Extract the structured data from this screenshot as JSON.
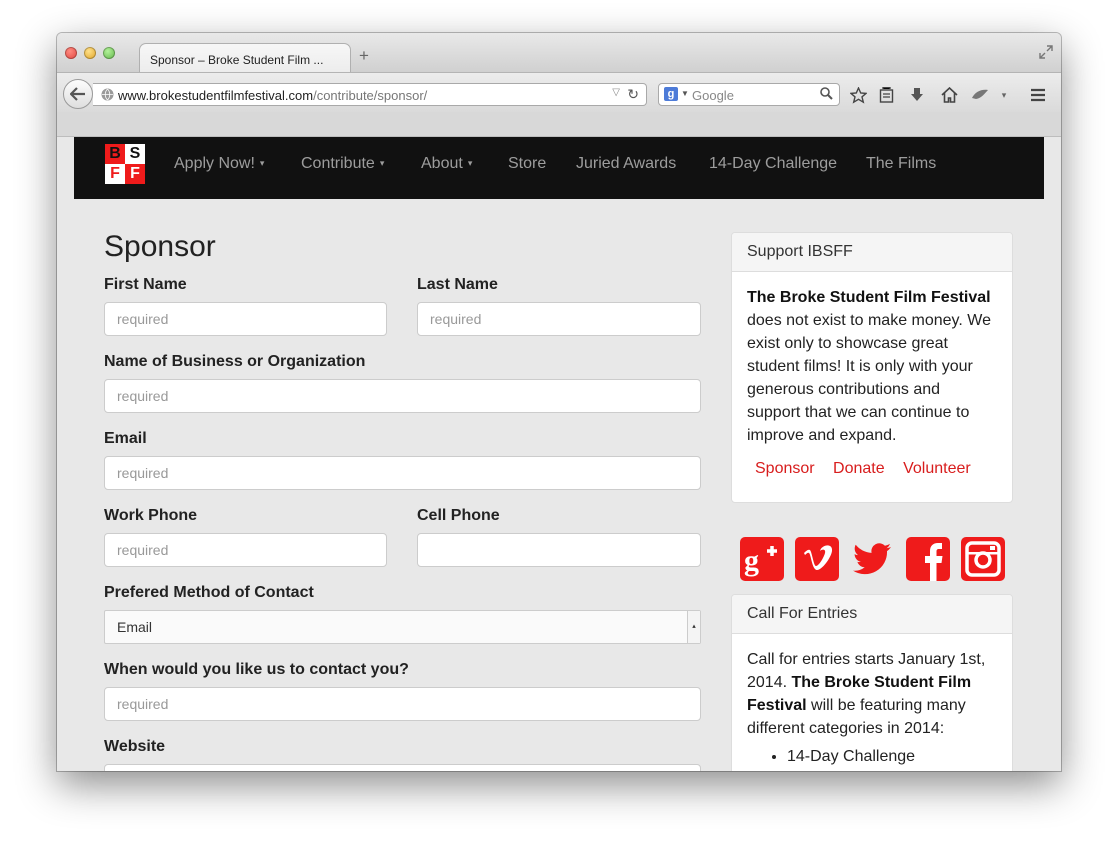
{
  "browser": {
    "tab_title": "Sponsor – Broke Student Film ...",
    "new_tab_symbol": "+",
    "url_host": "www.brokestudentfilmfestival.com",
    "url_path": "/contribute/sponsor/",
    "search_placeholder": "Google"
  },
  "site": {
    "logo_letters": [
      "B",
      "S",
      "F",
      "F"
    ],
    "nav": [
      {
        "label": "Apply Now!",
        "dropdown": true
      },
      {
        "label": "Contribute",
        "dropdown": true
      },
      {
        "label": "About",
        "dropdown": true
      },
      {
        "label": "Store",
        "dropdown": false
      },
      {
        "label": "Juried Awards",
        "dropdown": false
      },
      {
        "label": "14-Day Challenge",
        "dropdown": false
      },
      {
        "label": "The Films",
        "dropdown": false
      }
    ],
    "caret_symbol": "▾"
  },
  "form": {
    "title": "Sponsor",
    "first_name": {
      "label": "First Name",
      "placeholder": "required"
    },
    "last_name": {
      "label": "Last Name",
      "placeholder": "required"
    },
    "business": {
      "label": "Name of Business or Organization",
      "placeholder": "required"
    },
    "email": {
      "label": "Email",
      "placeholder": "required"
    },
    "work_phone": {
      "label": "Work Phone",
      "placeholder": "required"
    },
    "cell_phone": {
      "label": "Cell Phone",
      "placeholder": ""
    },
    "contact_method": {
      "label": "Prefered Method of Contact",
      "value": "Email"
    },
    "contact_time": {
      "label": "When would you like us to contact you?",
      "placeholder": "required"
    },
    "website": {
      "label": "Website"
    }
  },
  "sidebar": {
    "support": {
      "heading": "Support IBSFF",
      "bold": "The Broke Student Film Festival",
      "text": " does not exist to make money. We exist only to showcase great student films! It is only with your generous contributions and support that we can continue to improve and expand.",
      "links": [
        "Sponsor",
        "Donate",
        "Volunteer"
      ]
    },
    "social_icons": [
      "google-plus-icon",
      "vimeo-icon",
      "twitter-icon",
      "facebook-icon",
      "instagram-icon"
    ],
    "entries": {
      "heading": "Call For Entries",
      "text1": "Call for entries starts January 1st, 2014. ",
      "bold": "The Broke Student Film Festival",
      "text2": " will be featuring many different categories in 2014:",
      "items": [
        "14-Day Challenge"
      ]
    }
  },
  "colors": {
    "accent_red": "#ef1b1b",
    "nav_bg": "#111111",
    "page_bg": "#e8e8e8"
  }
}
